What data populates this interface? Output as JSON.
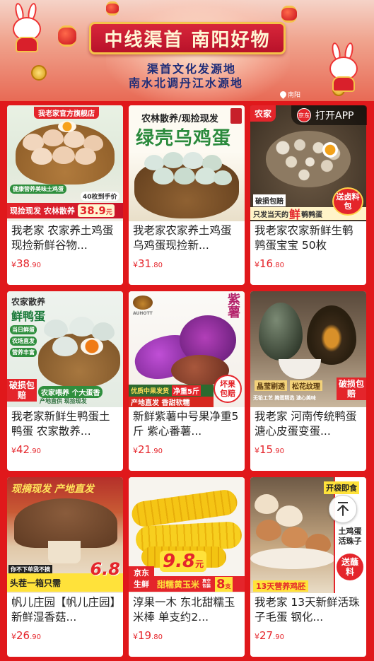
{
  "banner": {
    "title": "中线渠首 南阳好物",
    "subtitle_line1": "渠首文化发源地",
    "subtitle_line2": "南水北调丹江水源地",
    "location": "南阳"
  },
  "open_app": {
    "logo_text": "京东",
    "label": "打开APP"
  },
  "products": [
    {
      "name": "我老家 农家养土鸡蛋现捡新鲜谷物...",
      "price_int": "38",
      "price_dec": ".90",
      "badges": {
        "store": "我老家官方旗舰店",
        "promo": "40枚到手价",
        "strip_left": "现捡现发 农林散养",
        "strip_price": "38.9",
        "strip_unit": "元",
        "slogan": "健康营养美味土鸡蛋"
      }
    },
    {
      "name": "我老家农家养土鸡蛋乌鸡蛋现捡新...",
      "price_int": "31",
      "price_dec": ".80",
      "badges": {
        "top": "农林散养/现捡现发",
        "big": "绿壳乌鸡蛋"
      }
    },
    {
      "name": "我老家农家新鲜生鹌鹑蛋宝宝 50枚",
      "price_int": "16",
      "price_dec": ".80",
      "badges": {
        "top": "农家",
        "left": "破损包赔",
        "bottom_pre": "只发当天的",
        "bottom_key": "鲜",
        "bottom_post": "鹌鹑蛋",
        "right": "送卤料包"
      }
    },
    {
      "name": "我老家新鲜生鸭蛋土鸭蛋 农家散养...",
      "price_int": "42",
      "price_dec": ".90",
      "badges": {
        "top1": "农家散养",
        "top2": "鲜鸭蛋",
        "side1": "当日鲜蛋",
        "side2": "农场直发",
        "side3": "营养丰富",
        "left": "破损包赔",
        "bottom": "农家喂养 个大蛋香",
        "bottom2": "产地直供 现捡现发"
      }
    },
    {
      "name": "新鲜紫薯中号果净重5斤 紫心番薯...",
      "price_int": "21",
      "price_dec": ".90",
      "badges": {
        "corner": "紫薯",
        "strip1": "优质中果发货",
        "strip2": "净重5斤",
        "strip3": "产地直发 香甜软糯",
        "right": "坏果包赔",
        "logo": "AUHOTT"
      }
    },
    {
      "name": "我老家 河南传统鸭蛋溏心皮蛋变蛋...",
      "price_int": "15",
      "price_dec": ".90",
      "badges": {
        "mid1": "晶莹剔透",
        "mid2": "松花纹理",
        "right": "破损包赔",
        "bottom": "无铅工艺 腌蛋精选 溏心美味"
      }
    },
    {
      "name": "帆儿庄园【帆儿庄园】新鲜湿香菇...",
      "price_int": "26",
      "price_dec": ".90",
      "badges": {
        "top": "现摘现发 产地直发",
        "pre": "你不下单我不摘",
        "strip": "头茬一箱只需",
        "price": "6.8"
      }
    },
    {
      "name": "淳果一木 东北甜糯玉米棒 单支约2...",
      "price_int": "19",
      "price_dec": ".80",
      "badges": {
        "brand": "京东生鲜",
        "price": "9.8",
        "unit": "元",
        "strip": "甜糯黄玉米",
        "vacuum": "真空包装",
        "count": "8",
        "count_unit": "支"
      }
    },
    {
      "name": "我老家 13天新鲜活珠子毛蛋 钢化...",
      "price_int": "27",
      "price_dec": ".90",
      "badges": {
        "top": "开袋即食",
        "mid": "土鸡蛋活珠子",
        "right": "送蘸料",
        "bottom": "13天营养鸡胚"
      }
    }
  ],
  "colors": {
    "page_bg": "#e0181b",
    "price": "#e5252b",
    "gold": "#f5c24a"
  },
  "controls": {
    "back_to_top_icon": "arrow-up-icon"
  }
}
